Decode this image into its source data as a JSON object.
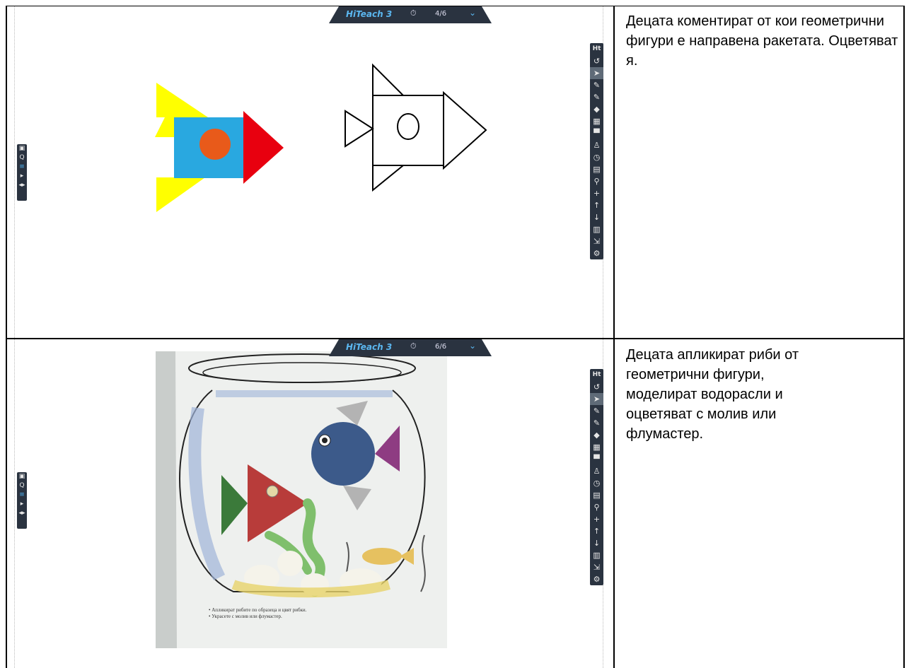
{
  "toolbar": {
    "app_name": "HiTeach 3",
    "clock_icon": "clock-icon",
    "chevron_icon": "chevron-down-icon"
  },
  "rows": [
    {
      "page_indicator": "4/6",
      "caption": "Децата коментират от кои геометрични фигури е направена ракетата. Оцветяват я."
    },
    {
      "page_indicator": "6/6",
      "caption": "Децата апликират риби от геометрични фигури, моделират водорасли и оцветяват с молив или флумастер."
    }
  ],
  "worksheet_text": [
    "• Апликират рибите по образеца и цвят рибки.",
    "• Украсете с молив или флумастер."
  ],
  "right_toolbar_icons": [
    "hiteach-logo-icon",
    "undo-icon",
    "cursor-icon",
    "pen-icon",
    "pen-2-icon",
    "eraser-icon",
    "camera-icon",
    "stamp-icon",
    "person-icon",
    "timer-icon",
    "calendar-icon",
    "zoom-icon",
    "add-icon",
    "up-arrow-icon",
    "down-arrow-icon",
    "trash-icon",
    "exit-icon",
    "settings-icon"
  ],
  "left_toolbar_icons": [
    "image-icon",
    "search-icon",
    "menu-icon",
    "play-icon",
    "volume-icon"
  ],
  "colors": {
    "toolbar_bg": "#2a3340",
    "accent": "#5bb7f0",
    "rocket_yellow": "#ffff00",
    "rocket_blue": "#29a8e0",
    "rocket_red": "#e8000f",
    "rocket_orange": "#e85a1a"
  }
}
